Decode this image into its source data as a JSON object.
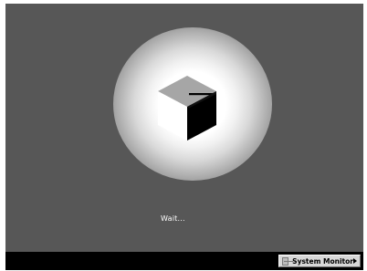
{
  "screen": {
    "background_color": "#575757",
    "logo": "cube-logo-icon",
    "status_text": "Wait..."
  },
  "status_bar": {
    "background_color": "#000000",
    "system_monitor_button": {
      "label": "System Monitor",
      "icon": "monitor-icon",
      "arrow_icon": "chevron-right-icon"
    }
  }
}
